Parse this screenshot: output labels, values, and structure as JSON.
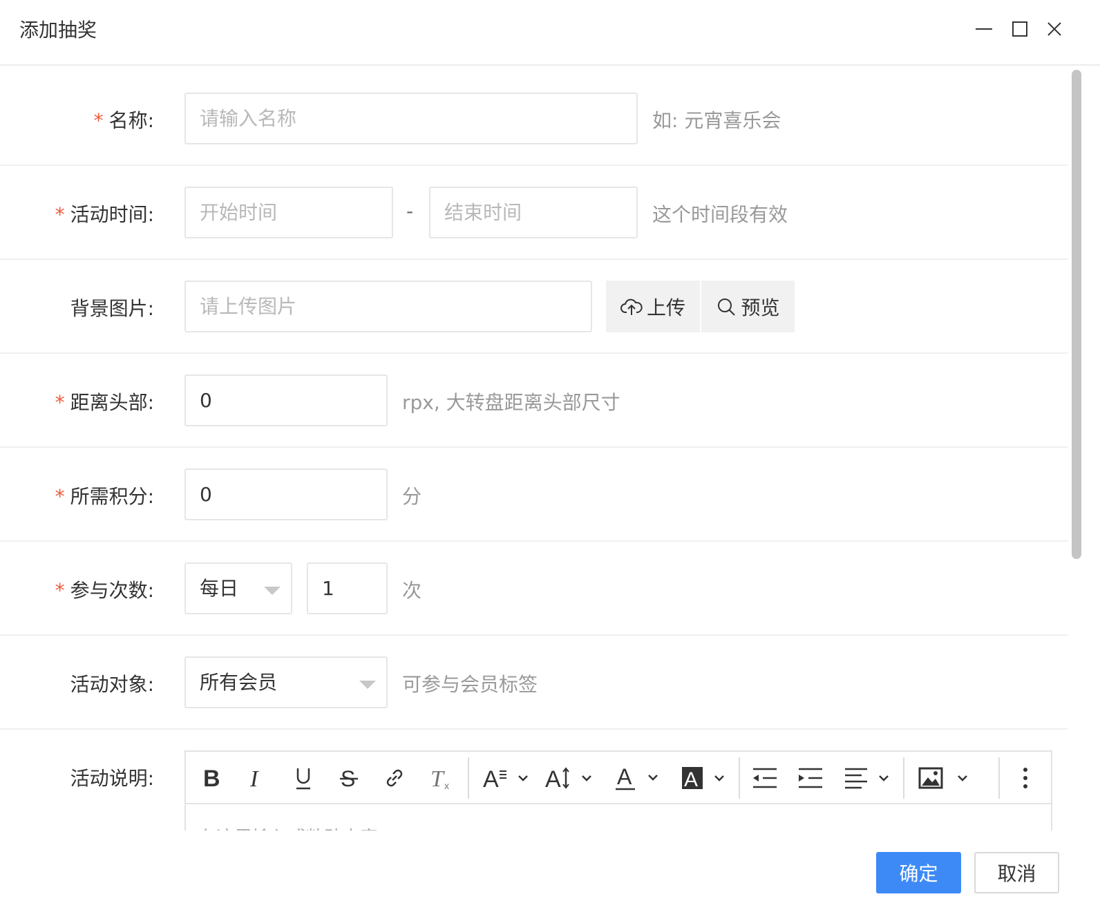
{
  "window": {
    "title": "添加抽奖"
  },
  "form": {
    "name": {
      "required": true,
      "label": "名称:",
      "placeholder": "请输入名称",
      "hint": "如: 元宵喜乐会"
    },
    "time": {
      "required": true,
      "label": "活动时间:",
      "start_placeholder": "开始时间",
      "separator": "-",
      "end_placeholder": "结束时间",
      "hint": "这个时间段有效"
    },
    "background": {
      "required": false,
      "label": "背景图片:",
      "placeholder": "请上传图片",
      "upload_label": "上传",
      "preview_label": "预览"
    },
    "top_distance": {
      "required": true,
      "label": "距离头部:",
      "value": "0",
      "hint": "rpx, 大转盘距离头部尺寸"
    },
    "points": {
      "required": true,
      "label": "所需积分:",
      "value": "0",
      "hint": "分"
    },
    "participation": {
      "required": true,
      "label": "参与次数:",
      "period": "每日",
      "count": "1",
      "hint": "次"
    },
    "target": {
      "required": false,
      "label": "活动对象:",
      "value": "所有会员",
      "hint": "可参与会员标签"
    },
    "description": {
      "label": "活动说明:",
      "placeholder": "在这里输入或粘贴内容",
      "toolbar": [
        "bold-icon",
        "italic-icon",
        "underline-icon",
        "strikethrough-icon",
        "link-icon",
        "clear-format-icon",
        "heading-icon",
        "font-size-icon",
        "font-color-icon",
        "background-color-icon",
        "outdent-icon",
        "indent-icon",
        "align-icon",
        "image-icon",
        "more-icon"
      ]
    }
  },
  "required_mark": "*",
  "footer": {
    "confirm": "确定",
    "cancel": "取消"
  },
  "colors": {
    "primary": "#3d8af7",
    "required": "#f05a3c",
    "hint": "#999999",
    "placeholder": "#b8b8b8"
  }
}
